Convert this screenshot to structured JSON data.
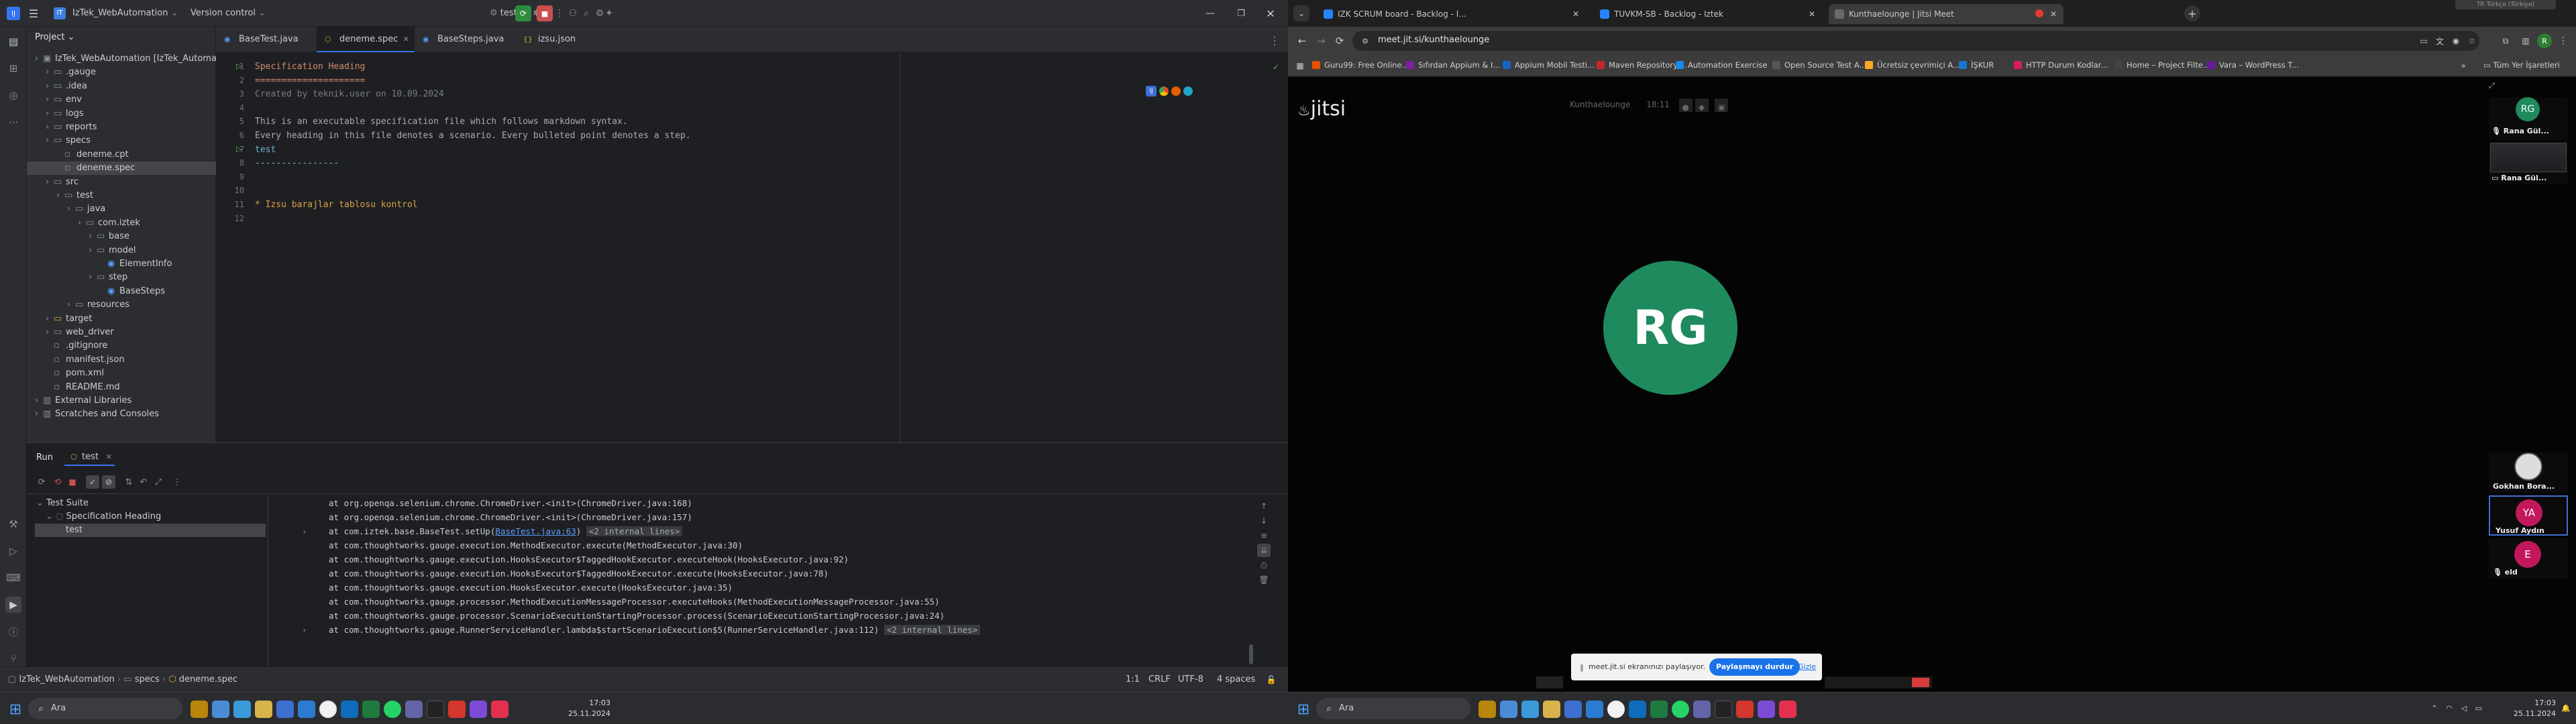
{
  "ide": {
    "project_name": "IzTek_WebAutomation",
    "version_control": "Version control",
    "run_config": "test",
    "tool_window_title": "Project",
    "tree": [
      {
        "label": "IzTek_WebAutomation [IzTek_Automati",
        "indent": 0,
        "kind": "module"
      },
      {
        "label": ".gauge",
        "indent": 1,
        "kind": "folder"
      },
      {
        "label": ".idea",
        "indent": 1,
        "kind": "folder"
      },
      {
        "label": "env",
        "indent": 1,
        "kind": "folder"
      },
      {
        "label": "logs",
        "indent": 1,
        "kind": "folder"
      },
      {
        "label": "reports",
        "indent": 1,
        "kind": "folder"
      },
      {
        "label": "specs",
        "indent": 1,
        "kind": "folder"
      },
      {
        "label": "deneme.cpt",
        "indent": 2,
        "kind": "file"
      },
      {
        "label": "deneme.spec",
        "indent": 2,
        "kind": "file",
        "selected": true
      },
      {
        "label": "src",
        "indent": 1,
        "kind": "folder"
      },
      {
        "label": "test",
        "indent": 2,
        "kind": "folder"
      },
      {
        "label": "java",
        "indent": 3,
        "kind": "folder"
      },
      {
        "label": "com.iztek",
        "indent": 4,
        "kind": "package"
      },
      {
        "label": "base",
        "indent": 5,
        "kind": "package"
      },
      {
        "label": "model",
        "indent": 5,
        "kind": "package"
      },
      {
        "label": "ElementInfo",
        "indent": 6,
        "kind": "class"
      },
      {
        "label": "step",
        "indent": 5,
        "kind": "package"
      },
      {
        "label": "BaseSteps",
        "indent": 6,
        "kind": "class"
      },
      {
        "label": "resources",
        "indent": 3,
        "kind": "folder"
      },
      {
        "label": "target",
        "indent": 1,
        "kind": "folder-excluded"
      },
      {
        "label": "web_driver",
        "indent": 1,
        "kind": "folder"
      },
      {
        "label": ".gitignore",
        "indent": 1,
        "kind": "file"
      },
      {
        "label": "manifest.json",
        "indent": 1,
        "kind": "file"
      },
      {
        "label": "pom.xml",
        "indent": 1,
        "kind": "file"
      },
      {
        "label": "README.md",
        "indent": 1,
        "kind": "file"
      },
      {
        "label": "External Libraries",
        "indent": 0,
        "kind": "lib"
      },
      {
        "label": "Scratches and Consoles",
        "indent": 0,
        "kind": "lib"
      }
    ],
    "tabs": [
      "BaseTest.java",
      "deneme.spec",
      "BaseSteps.java",
      "izsu.json"
    ],
    "active_tab": 1,
    "code": [
      "Specification Heading",
      "=====================",
      "Created by teknik.user on 10.09.2024",
      "",
      "This is an executable specification file which follows markdown syntax.",
      "Every heading in this file denotes a scenario. Every bulleted point denotes a step.",
      "test",
      "----------------",
      "",
      "",
      "* Izsu barajlar tablosu kontrol",
      ""
    ],
    "run": {
      "label": "Run",
      "tab": "test",
      "tree": [
        "Test Suite",
        "Specification Heading",
        "test"
      ],
      "log": [
        {
          "text": "at org.openqa.selenium.chrome.ChromeDriver.<init>(ChromeDriver.java:168)"
        },
        {
          "text": "at org.openqa.selenium.chrome.ChromeDriver.<init>(ChromeDriver.java:157)"
        },
        {
          "pre": "at com.iztek.base.BaseTest.setUp(",
          "link": "BaseTest.java:63",
          "post": ") ",
          "fold": "<2 internal lines>"
        },
        {
          "text": "at com.thoughtworks.gauge.execution.MethodExecutor.execute(MethodExecutor.java:30)"
        },
        {
          "text": "at com.thoughtworks.gauge.execution.HooksExecutor$TaggedHookExecutor.executeHook(HooksExecutor.java:92)"
        },
        {
          "text": "at com.thoughtworks.gauge.execution.HooksExecutor$TaggedHookExecutor.execute(HooksExecutor.java:78)"
        },
        {
          "text": "at com.thoughtworks.gauge.execution.HooksExecutor.execute(HooksExecutor.java:35)"
        },
        {
          "text": "at com.thoughtworks.gauge.processor.MethodExecutionMessageProcessor.executeHooks(MethodExecutionMessageProcessor.java:55)"
        },
        {
          "text": "at com.thoughtworks.gauge.processor.ScenarioExecutionStartingProcessor.process(ScenarioExecutionStartingProcessor.java:24)"
        },
        {
          "pre": "at com.thoughtworks.gauge.RunnerServiceHandler.lambda$startScenarioExecution$5(RunnerServiceHandler.java:112) ",
          "fold": "<2 internal lines>"
        }
      ]
    },
    "status": {
      "breadcrumb": [
        "IzTek_WebAutomation",
        "specs",
        "deneme.spec"
      ],
      "position": "1:1",
      "line_sep": "CRLF",
      "encoding": "UTF-8",
      "indent": "4 spaces"
    }
  },
  "browser": {
    "tabs": [
      {
        "title": "IZK SCRUM board - Backlog - I..."
      },
      {
        "title": "TUVKM-SB - Backlog - Iztek"
      },
      {
        "title": "Kunthaelounge | Jitsi Meet",
        "active": true
      }
    ],
    "url": "meet.jit.si/kunthaelounge",
    "bookmarks": [
      "Guru99: Free Online...",
      "Sıfırdan Appium & I...",
      "Appium Mobil Testi...",
      "Maven Repository:...",
      "Automation Exercise",
      "Open Source Test A...",
      "Ücretsiz çevrimiçi A...",
      "İŞKUR",
      "HTTP Durum Kodlar...",
      "Home – Project Filte...",
      "Vara – WordPress T..."
    ],
    "all_bookmarks": "Tüm Yer İşaretleri",
    "jitsi": {
      "logo": "jitsi",
      "room": "Kunthaelounge",
      "timer": "18:11",
      "speaker_initials": "RG",
      "speaker_color": "#1e8a5e",
      "participants": [
        {
          "name": "Rana Gül...",
          "kind": "video"
        },
        {
          "name": "Rana Gül...",
          "kind": "screen"
        },
        {
          "name": "Gokhan Bora...",
          "kind": "avatar"
        },
        {
          "name": "Yusuf Aydın",
          "kind": "initials",
          "initials": "YA",
          "color": "#c2185b"
        },
        {
          "name": "eld",
          "kind": "initials",
          "initials": "E",
          "color": "#c2185b"
        }
      ],
      "share_notice": "meet.jit.si ekranınızı paylaşıyor.",
      "stop_share": "Paylaşmayı durdur",
      "hide": "Gizle"
    },
    "top_notice": "TR Türkçe (Türkiye)"
  },
  "taskbars": [
    {
      "search": "Ara",
      "time": "17:03",
      "date": "25.11.2024"
    },
    {
      "search": "Ara",
      "time": "17:03",
      "date": "25.11.2024"
    }
  ]
}
